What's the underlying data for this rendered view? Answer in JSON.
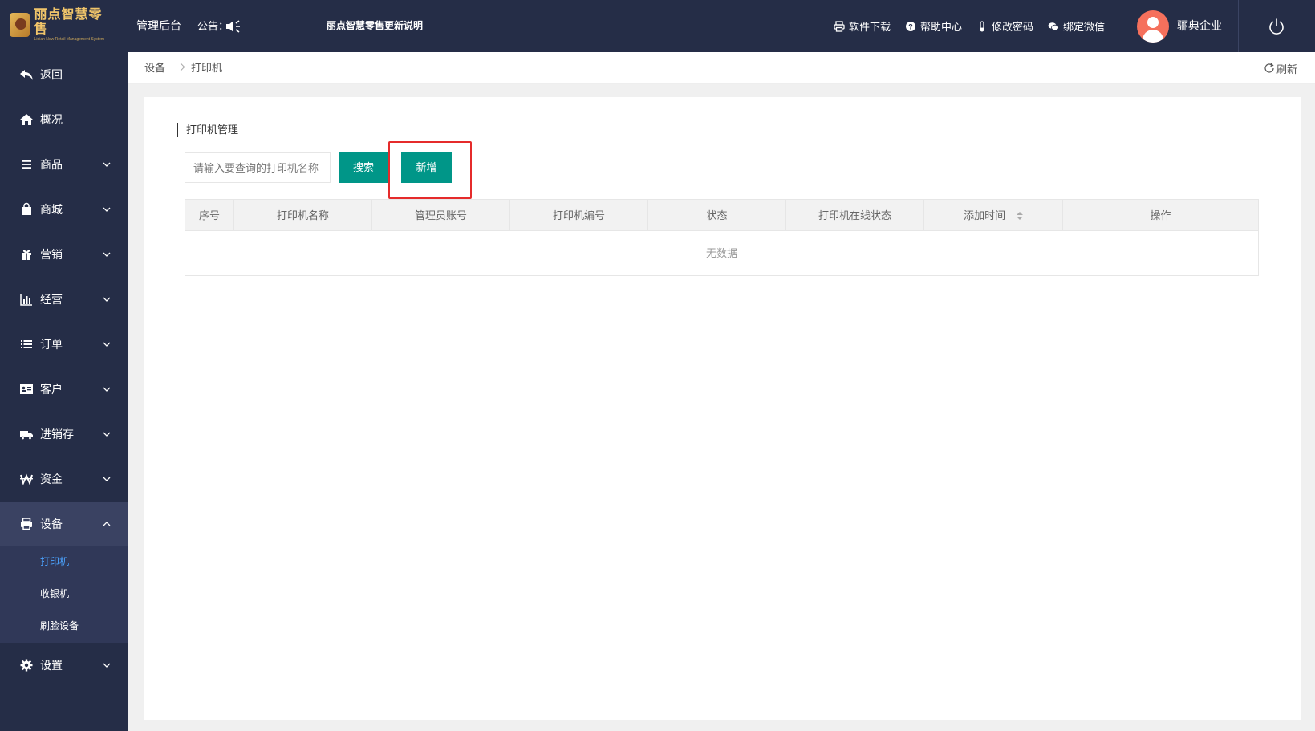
{
  "header": {
    "logo_title": "丽点智慧零售",
    "logo_sub": "Lidian New Retail Management System",
    "admin": "管理后台",
    "notice_label": "公告：",
    "notice_text": "丽点智慧零售更新说明",
    "menu": [
      {
        "label": "软件下载",
        "icon": "printer-icon"
      },
      {
        "label": "帮助中心",
        "icon": "question-icon"
      },
      {
        "label": "修改密码",
        "icon": "thermometer-icon"
      },
      {
        "label": "绑定微信",
        "icon": "chat-icon"
      }
    ],
    "company": "骊典企业",
    "accent": "#252d47"
  },
  "sidebar": {
    "items": [
      {
        "label": "返回",
        "icon": "back-arrow-icon"
      },
      {
        "label": "概况",
        "icon": "home-icon"
      },
      {
        "label": "商品",
        "icon": "menu-lines-icon"
      },
      {
        "label": "商城",
        "icon": "bag-icon"
      },
      {
        "label": "营销",
        "icon": "gift-icon"
      },
      {
        "label": "经营",
        "icon": "bar-chart-icon"
      },
      {
        "label": "订单",
        "icon": "list-icon"
      },
      {
        "label": "客户",
        "icon": "id-card-icon"
      },
      {
        "label": "进销存",
        "icon": "truck-icon"
      },
      {
        "label": "资金",
        "icon": "won-icon"
      },
      {
        "label": "设备",
        "icon": "printer-icon"
      },
      {
        "label": "设置",
        "icon": "gear-icon"
      }
    ],
    "sub_items": [
      {
        "label": "打印机"
      },
      {
        "label": "收银机"
      },
      {
        "label": "刷脸设备"
      }
    ]
  },
  "breadcrumb": {
    "parent": "设备",
    "current": "打印机",
    "refresh": "刷新"
  },
  "main": {
    "section_title": "打印机管理",
    "search_placeholder": "请输入要查询的打印机名称",
    "search_button": "搜索",
    "add_button": "新增",
    "button_color": "#009688",
    "table": {
      "columns": [
        "序号",
        "打印机名称",
        "管理员账号",
        "打印机编号",
        "状态",
        "打印机在线状态",
        "添加时间",
        "操作"
      ],
      "empty_text": "无数据"
    }
  }
}
